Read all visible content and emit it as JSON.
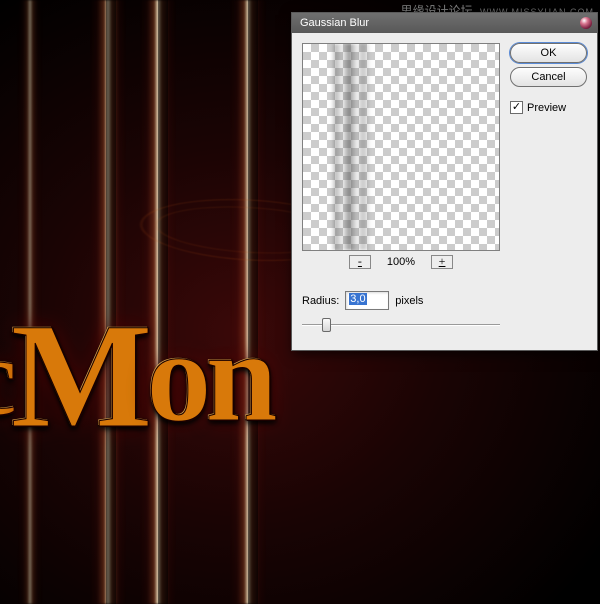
{
  "watermark": {
    "text": "思缘设计论坛",
    "url": "WWW.MISSYUAN.COM"
  },
  "artwork": {
    "text_fragment": "cMon"
  },
  "dialog": {
    "title": "Gaussian Blur",
    "zoom": {
      "minus": "-",
      "percent": "100%",
      "plus": "+"
    },
    "radius": {
      "label": "Radius:",
      "value": "3,0",
      "unit": "pixels"
    },
    "buttons": {
      "ok": "OK",
      "cancel": "Cancel"
    },
    "preview": {
      "checked": true,
      "label": "Preview"
    }
  }
}
